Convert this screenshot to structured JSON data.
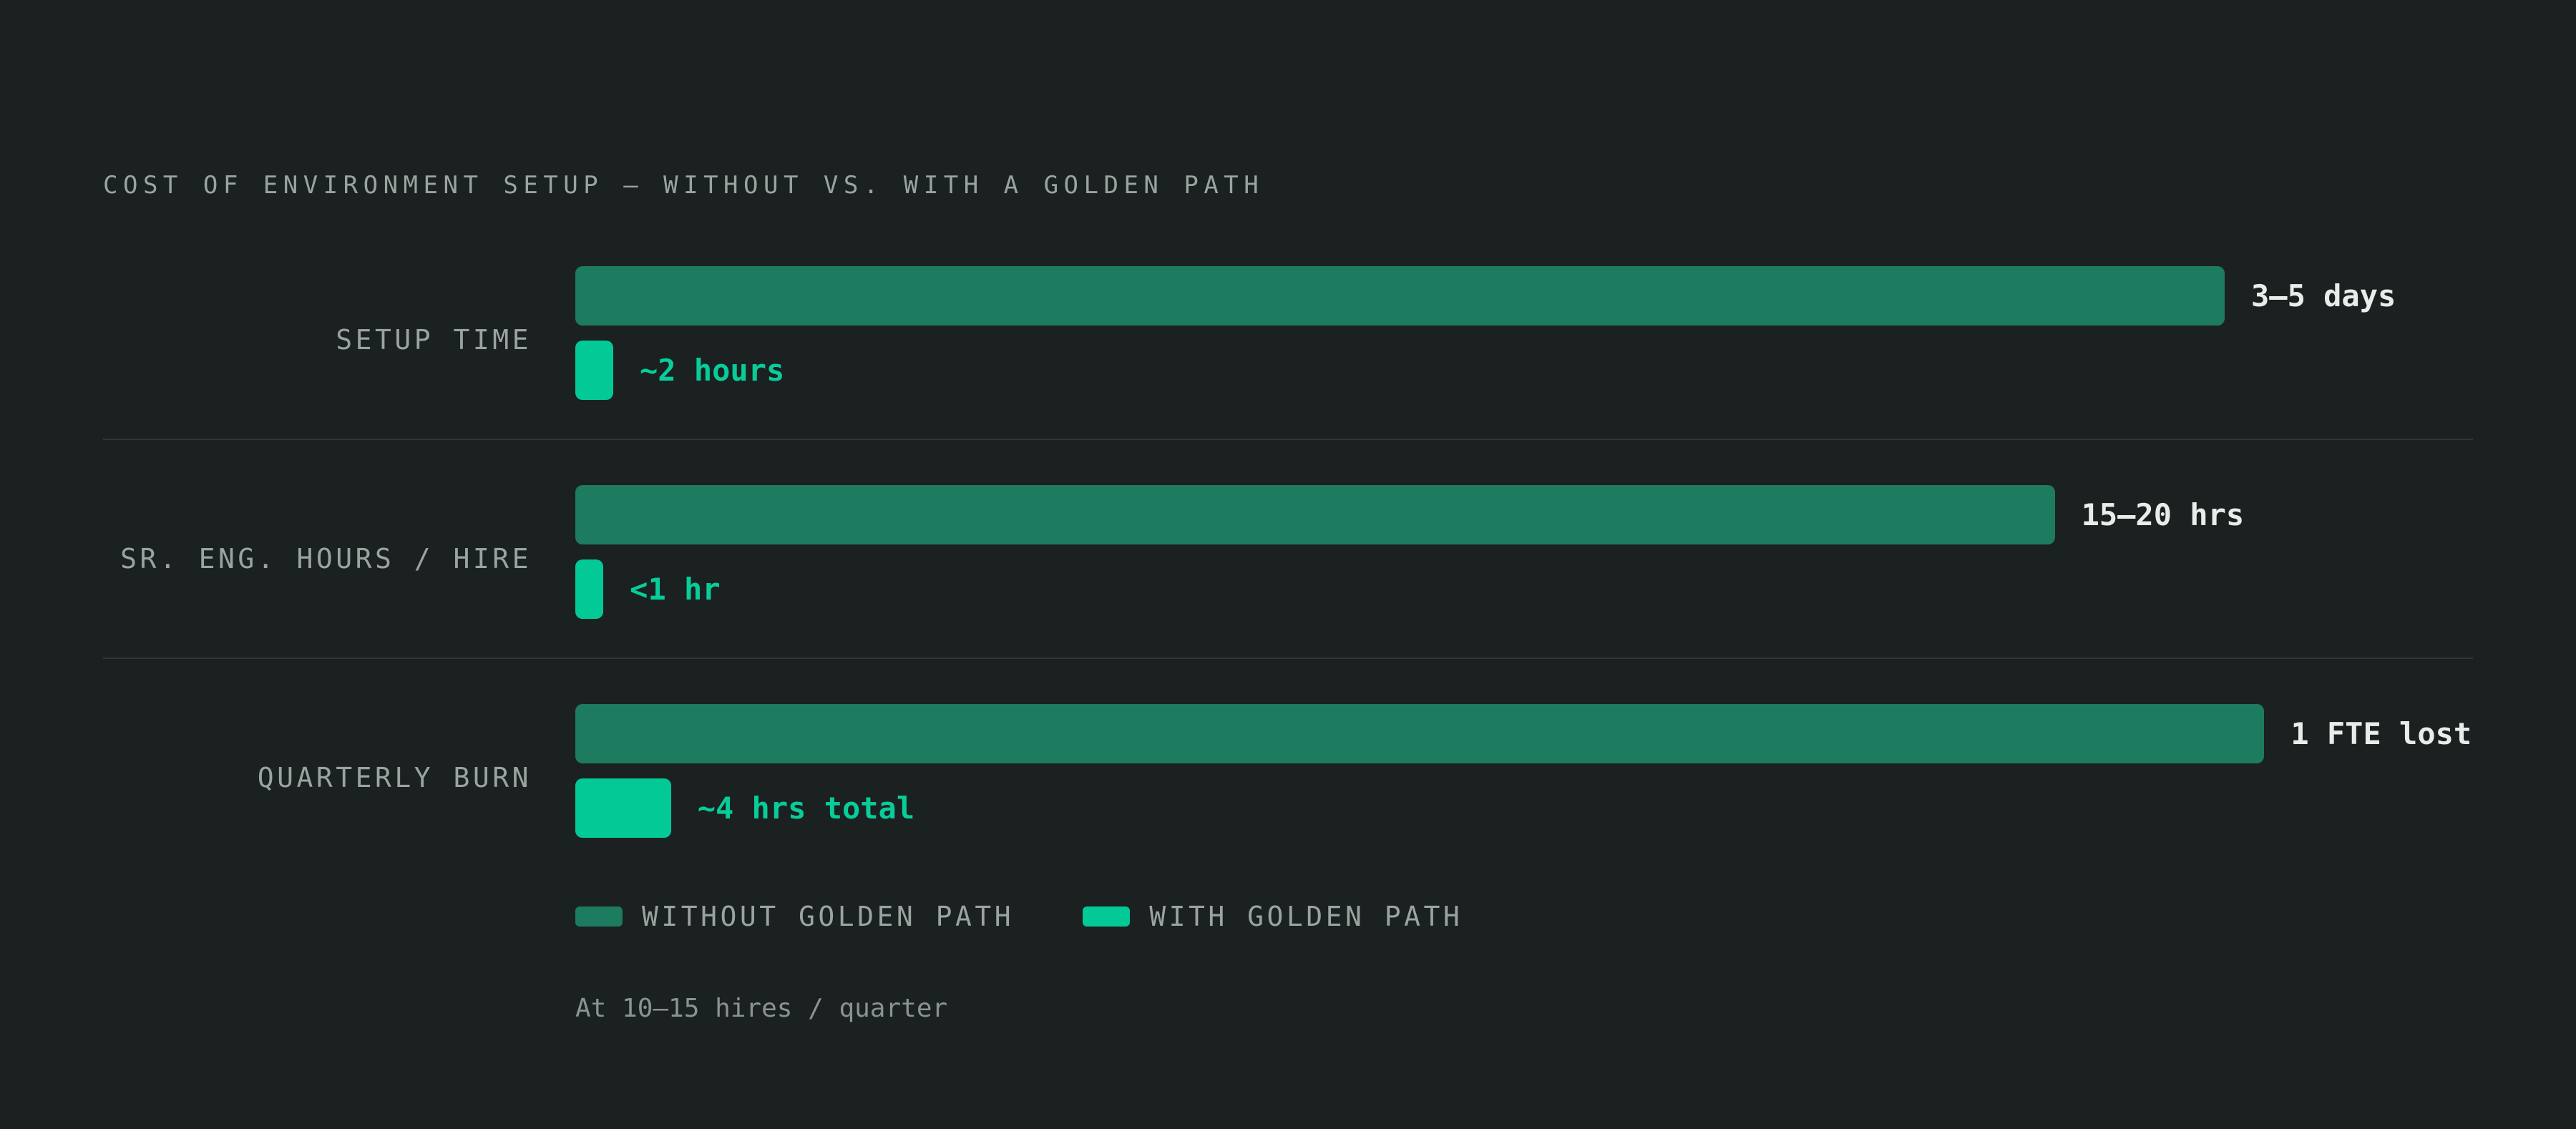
{
  "chart_data": {
    "type": "bar",
    "orientation": "horizontal",
    "title": "COST OF ENVIRONMENT SETUP — WITHOUT VS. WITH A GOLDEN PATH",
    "categories": [
      "SETUP TIME",
      "SR. ENG. HOURS / HIRE",
      "QUARTERLY BURN"
    ],
    "series": [
      {
        "name": "WITHOUT GOLDEN PATH",
        "color": "#1d7b5f",
        "values": [
          1.0,
          0.897,
          1.024
        ],
        "labels": [
          "3–5 days",
          "15–20 hrs",
          "1 FTE lost"
        ]
      },
      {
        "name": "WITH GOLDEN PATH",
        "color": "#03c997",
        "values": [
          0.023,
          0.017,
          0.058
        ],
        "labels": [
          "~2 hours",
          "<1 hr",
          "~4 hrs total"
        ]
      }
    ],
    "footnote": "At 10–15 hires / quarter",
    "grid": false,
    "legend_position": "bottom-left"
  }
}
